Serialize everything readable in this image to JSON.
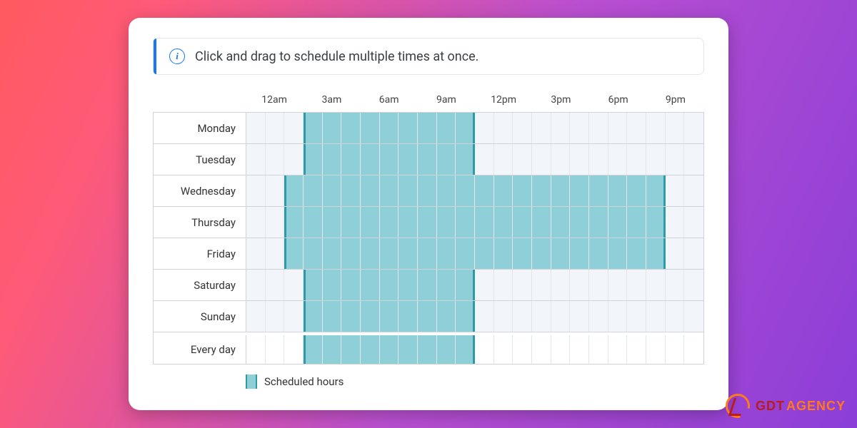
{
  "info": {
    "message": "Click and drag to schedule multiple times at once."
  },
  "timeLabels": [
    "12am",
    "3am",
    "6am",
    "9am",
    "12pm",
    "3pm",
    "6pm",
    "9pm"
  ],
  "days": [
    {
      "label": "Monday",
      "start": 3,
      "end": 12
    },
    {
      "label": "Tuesday",
      "start": 3,
      "end": 12
    },
    {
      "label": "Wednesday",
      "start": 2,
      "end": 22
    },
    {
      "label": "Thursday",
      "start": 2,
      "end": 22
    },
    {
      "label": "Friday",
      "start": 2,
      "end": 22
    },
    {
      "label": "Saturday",
      "start": 3,
      "end": 12
    },
    {
      "label": "Sunday",
      "start": 3,
      "end": 12
    }
  ],
  "everyDay": {
    "label": "Every day",
    "start": 3,
    "end": 12
  },
  "legend": {
    "label": "Scheduled hours"
  },
  "watermark": {
    "word1": "GDT",
    "word2": "AGENCY"
  }
}
